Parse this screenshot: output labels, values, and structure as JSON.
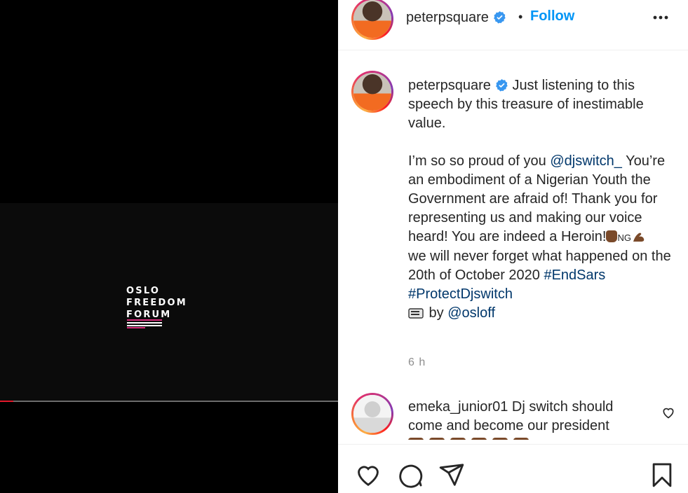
{
  "media": {
    "logo_lines": [
      "OSLO",
      "FREEDOM",
      "FORUM"
    ],
    "progress": 0.04,
    "progress_color": "#e1192b"
  },
  "header": {
    "username": "peterpsquare",
    "verified": true,
    "separator": "•",
    "follow_label": "Follow",
    "follow_color": "#0095f6",
    "more_icon": "more-horizontal-icon"
  },
  "caption": {
    "username": "peterpsquare",
    "line1": "Just listening to this speech by this treasure of inestimable value.",
    "proud_prefix": "I’m so so proud of you ",
    "mention": "@djswitch_",
    "body": "You’re an embodiment of a Nigerian Youth the Government are afraid of! Thank you for representing us and making our voice heard! You are indeed a Heroin!",
    "ng": "NG",
    "never_forget": "we will never forget what happened on the 20th of October 2020 ",
    "hashtag1": "#EndSars",
    "hashtag2": "#ProtectDjswitch",
    "by_label": " by ",
    "credit": "@osloff",
    "time": "6 h"
  },
  "comment": {
    "username": "emeka_junior01",
    "text": "Dj switch should come and become our president"
  },
  "actions": {
    "like_icon": "heart-icon",
    "comment_icon": "comment-icon",
    "share_icon": "share-icon",
    "save_icon": "bookmark-icon"
  }
}
